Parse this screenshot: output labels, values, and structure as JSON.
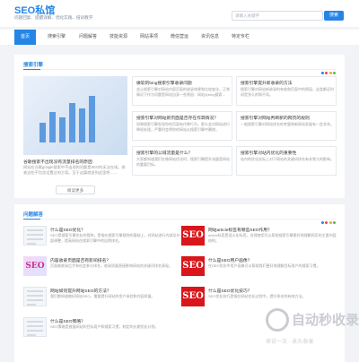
{
  "site": {
    "logo": "SEO私馆",
    "slogan": "问题回复、提醒详解、优化实践、培训教学"
  },
  "search": {
    "placeholder": "请输入关键字",
    "button": "搜索"
  },
  "nav": [
    "首页",
    "搜索引擎",
    "问题解答",
    "技能资源",
    "网站事项",
    "微信营运",
    "资讯信息",
    "特定专栏"
  ],
  "sections": {
    "engine": {
      "title": "搜索引擎",
      "featured": {
        "title": "谷歌搜索不出现没有流量排名的原因",
        "desc": "网站在谷歌google搜索中不出现的问题是SEO的无法在线。排查这些不包含设置过的方案。至于这篇就说到这里吧……"
      },
      "more": "阅读更多",
      "cards": [
        {
          "title": "做软的bing搜索引擎收录问题",
          "desc": "会让搜索引擎对网站内容页面的收录效果和比较变化，正常情况下作为问题是网站自身一些原因：网站从bing搜索..."
        },
        {
          "title": "搜索引擎提升新收录的方法",
          "desc": "搜索引擎对网站新收录的有效和页面中的原因，这类都还时间是多久的和不同。"
        },
        {
          "title": "搜索引擎对网站新页面是否存在作弊情况？",
          "desc": "如果搜索引擎发现你的页面有作弊行为，那么会对网站进行降权处理，严重时会将你的网站从搜索引擎中删除。"
        },
        {
          "title": "搜索引擎对网站判断新的网页的规则",
          "desc": "一般搜索引擎对网站排名的考量和新网站发展有一定关系。"
        },
        {
          "title": "搜索引擎的公域流量是什么？",
          "desc": "大家都知道我们在做网站优化时，搜索引擎提升流量是网站的重要目标。"
        },
        {
          "title": "搜索引擎对站内优化的重要性",
          "desc": "站内的优化实际上对于网站的关键词排名有非常大的影响。"
        }
      ]
    },
    "qa": {
      "title": "问题解答",
      "items": [
        {
          "thumb": "doc",
          "thumb_text": "",
          "title": "什么是SEO优化？",
          "desc": "SEO是搜索引擎优化的简称，是指在搜索引擎规则的基础上，对网站进行内部及外部调整，提高网站在搜索引擎中的自然排名。"
        },
        {
          "thumb": "red",
          "thumb_text": "SEO",
          "title": "网站article标签有哪些SEO作用？",
          "desc": "article标签是语义化标签，合理使用可以帮助搜索引擎更好地理解网页的主要内容结构。"
        },
        {
          "thumb": "pink",
          "thumb_text": "SEO",
          "title": "内容收录页面是否有影响排名？",
          "desc": "页面被收录后才有机会参与排名，收录质量直接影响网站的关键词排名表现。"
        },
        {
          "thumb": "red",
          "thumb_text": "SEO",
          "title": "什么是SEO用户画像？",
          "desc": "在SEO优化中用户画像可以帮助我们更好地理解目标用户的搜索习惯。"
        },
        {
          "thumb": "doc",
          "thumb_text": "",
          "title": "网站如何提升网站SEO的方法？",
          "desc": "我们都知道做好网站SEO，需要提升网站的用户体验和内容质量。"
        },
        {
          "thumb": "red",
          "thumb_text": "SEO",
          "title": "什么是SEO优化技巧？",
          "desc": "SEO优化技巧是指在网站优化过程中，提升排名的有效方法。"
        },
        {
          "thumb": "doc",
          "thumb_text": "",
          "title": "什么是SEO策略？",
          "desc": "SEO策略是根据网站的目标用户和搜索习惯，制定的长期优化计划。"
        }
      ]
    }
  },
  "watermark": {
    "title": "自动秒收录",
    "subtitle": "来访一次 · 永久收录"
  },
  "colors": {
    "accent": "#2585e6",
    "dots": [
      "#2585e6",
      "#e84b3c",
      "#f5a623",
      "#5cb85c"
    ]
  }
}
